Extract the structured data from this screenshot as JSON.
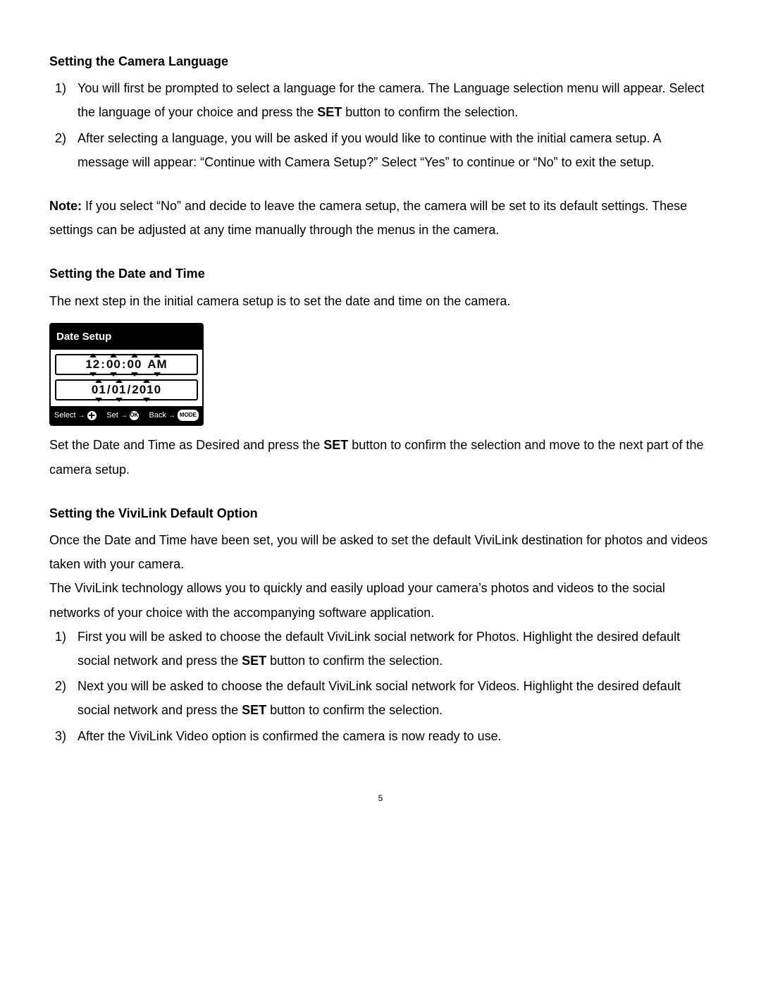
{
  "section1": {
    "heading": "Setting the Camera Language",
    "item1_a": "You will first be prompted to select a language for the camera. The Language selection menu will appear. Select the language of your choice and press the ",
    "item1_b": "SET",
    "item1_c": " button to confirm the selection.",
    "item2": "After selecting a language, you will be asked if you would like to continue with the initial camera setup. A message will appear: “Continue with Camera Setup?” Select “Yes” to continue or “No” to exit the setup.",
    "note_label": "Note:",
    "note_text": " If you select “No” and decide to leave the camera setup, the camera will be set to its default settings. These settings can be adjusted at any time manually through the menus in the camera."
  },
  "section2": {
    "heading": "Setting the Date and Time",
    "intro": "The next step in the initial camera setup is to set the date and time on the camera.",
    "panel": {
      "title": "Date Setup",
      "time": {
        "hh": "12",
        "mm": "00",
        "ss": "00",
        "ampm": "AM"
      },
      "date": {
        "dd": "01",
        "mo": "01",
        "yyyy": "2010"
      },
      "footer": {
        "select": "Select",
        "set": "Set",
        "back": "Back",
        "ok": "OK",
        "mode": "MODE"
      }
    },
    "after_a": "Set the Date and Time as Desired and press the ",
    "after_b": "SET",
    "after_c": " button to confirm the selection and move to the next part of the camera setup."
  },
  "section3": {
    "heading": "Setting the ViviLink Default Option",
    "p1": "Once the Date and Time have been set, you will be asked to set the default ViviLink destination for photos and videos taken with your camera.",
    "p2": "The ViviLink technology allows you to quickly and easily upload your camera’s photos and videos to the social networks of your choice with the accompanying software application.",
    "item1_a": "First you will be asked to choose the default ViviLink social network for Photos. Highlight the desired default social network and press the ",
    "item1_b": "SET",
    "item1_c": " button to confirm the selection.",
    "item2_a": "Next you will be asked to choose the default ViviLink social network for Videos. Highlight the desired default social network and press the ",
    "item2_b": "SET",
    "item2_c": " button to confirm the selection.",
    "item3": "After the ViviLink Video option is confirmed the camera is now ready to use."
  },
  "page_number": "5"
}
